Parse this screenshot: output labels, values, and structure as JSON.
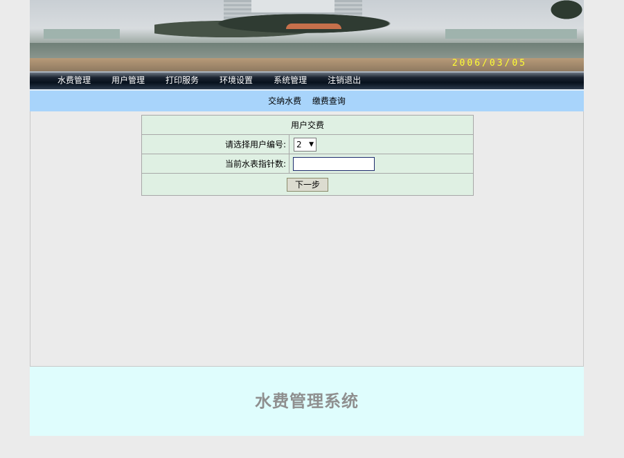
{
  "banner": {
    "date_stamp": "2006/03/05"
  },
  "nav": {
    "items": [
      {
        "label": "水费管理"
      },
      {
        "label": "用户管理"
      },
      {
        "label": "打印服务"
      },
      {
        "label": "环境设置"
      },
      {
        "label": "系统管理"
      },
      {
        "label": "注销退出"
      }
    ]
  },
  "subnav": {
    "items": [
      {
        "label": "交纳水费"
      },
      {
        "label": "缴费查询"
      }
    ]
  },
  "form": {
    "title": "用户交费",
    "user_id_label": "请选择用户编号:",
    "user_id_value": "2",
    "meter_label": "当前水表指针数:",
    "meter_value": "",
    "next_button": "下一步"
  },
  "footer": {
    "title": "水费管理系统"
  },
  "colors": {
    "nav_bg": "#07111d",
    "subnav_bg": "#a8d4fb",
    "form_bg": "#dff0e3",
    "footer_bg": "#dffdfd"
  }
}
